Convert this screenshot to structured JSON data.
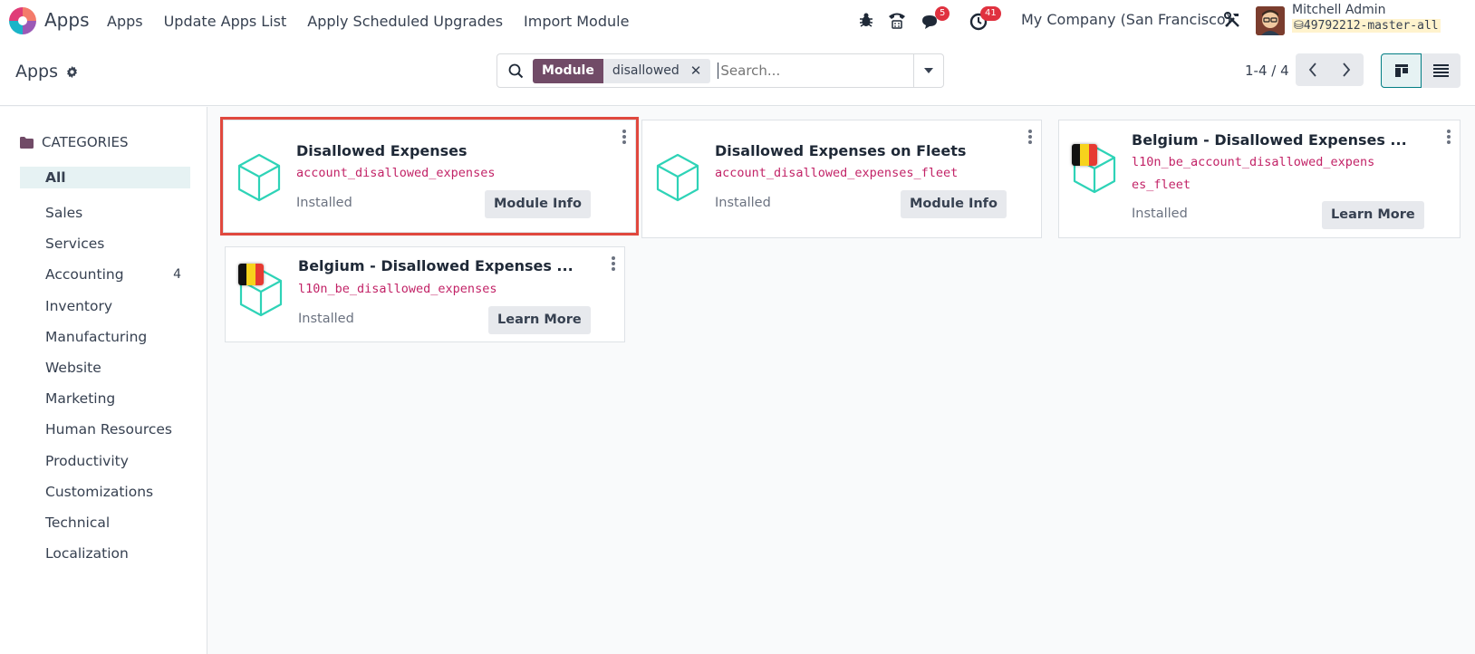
{
  "navbar": {
    "app_name": "Apps",
    "menu": [
      "Apps",
      "Update Apps List",
      "Apply Scheduled Upgrades",
      "Import Module"
    ],
    "messages_badge": "5",
    "activities_badge": "41",
    "company": "My Company (San Francisco)",
    "user_name": "Mitchell Admin",
    "database": "49792212-master-all"
  },
  "control_panel": {
    "breadcrumb": "Apps",
    "facet_category": "Module",
    "facet_value": "disallowed",
    "search_placeholder": "Search...",
    "pager": "1-4 / 4"
  },
  "sidebar": {
    "header": "CATEGORIES",
    "items": [
      {
        "label": "All",
        "count": ""
      },
      {
        "label": "Sales",
        "count": ""
      },
      {
        "label": "Services",
        "count": ""
      },
      {
        "label": "Accounting",
        "count": "4"
      },
      {
        "label": "Inventory",
        "count": ""
      },
      {
        "label": "Manufacturing",
        "count": ""
      },
      {
        "label": "Website",
        "count": ""
      },
      {
        "label": "Marketing",
        "count": ""
      },
      {
        "label": "Human Resources",
        "count": ""
      },
      {
        "label": "Productivity",
        "count": ""
      },
      {
        "label": "Customizations",
        "count": ""
      },
      {
        "label": "Technical",
        "count": ""
      },
      {
        "label": "Localization",
        "count": ""
      }
    ]
  },
  "modules": [
    {
      "title": "Disallowed Expenses",
      "technical_name": "account_disallowed_expenses",
      "status": "Installed",
      "button": "Module Info",
      "flag": "none"
    },
    {
      "title": "Disallowed Expenses on Fleets",
      "technical_name": "account_disallowed_expenses_fleet",
      "status": "Installed",
      "button": "Module Info",
      "flag": "none"
    },
    {
      "title": "Belgium - Disallowed Expenses ...",
      "technical_name_line1": "l10n_be_account_disallowed_expens",
      "technical_name_line2": "es_fleet",
      "status": "Installed",
      "button": "Learn More",
      "flag": "belgium"
    },
    {
      "title": "Belgium - Disallowed Expenses ...",
      "technical_name": "l10n_be_disallowed_expenses",
      "status": "Installed",
      "button": "Learn More",
      "flag": "belgium"
    }
  ],
  "colors": {
    "brand": "#714b67",
    "accent": "#017e84",
    "technical_name": "#c22367",
    "selection_outline": "#e0483e",
    "module_icon": "#2ed3b7"
  },
  "icons": [
    "odoo-logo-icon",
    "bug-icon",
    "phone-icon",
    "chat-icon",
    "clock-icon",
    "tools-icon",
    "database-icon",
    "gear-icon",
    "search-icon",
    "caret-down-icon",
    "chevron-left-icon",
    "chevron-right-icon",
    "kanban-view-icon",
    "list-view-icon",
    "folder-icon",
    "module-cube-icon",
    "kebab-menu-icon"
  ]
}
